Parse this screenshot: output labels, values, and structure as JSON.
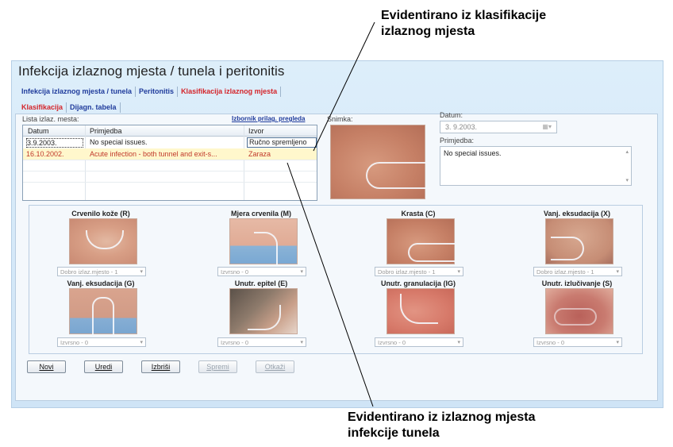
{
  "callouts": {
    "top": "Evidentirano iz klasifikacije\nizlaznog mjesta",
    "bottom": "Evidentirano iz izlaznog mjesta\ninfekcije tunela"
  },
  "window": {
    "title": "Infekcija izlaznog mjesta / tunela i peritonitis",
    "tabs": [
      {
        "label": "Infekcija izlaznog mjesta / tunela",
        "active": false
      },
      {
        "label": "Peritonitis",
        "active": false
      },
      {
        "label": "Klasifikacija izlaznog mjesta",
        "active": true
      }
    ],
    "subtabs": [
      {
        "label": "Klasifikacija",
        "active": true
      },
      {
        "label": "Dijagn. tabela",
        "active": false
      }
    ]
  },
  "list": {
    "label": "Lista izlaz. mesta:",
    "link": "Izbornik prilag. pregleda",
    "columns": [
      "Datum",
      "Primjedba",
      "Izvor"
    ],
    "rows": [
      {
        "date": "3.9.2003.",
        "note": "No special issues.",
        "source": "Ručno spremljeno"
      },
      {
        "date": "16.10.2002.",
        "note": "Acute infection - both tunnel and exit-s...",
        "source": "Zaraza"
      }
    ]
  },
  "details": {
    "snimka_label": "Snimka:",
    "datum_label": "Datum:",
    "datum_value": "3.  9.2003.",
    "primjedba_label": "Primjedba:",
    "primjedba_value": "No special issues."
  },
  "categories": [
    {
      "title": "Crvenilo kože (R)",
      "value": "Dobro izlaz.mjesto - 1",
      "photo": "skin1"
    },
    {
      "title": "Mjera crvenila (M)",
      "value": "Izvrsno - 0",
      "photo": "skin2"
    },
    {
      "title": "Krasta (C)",
      "value": "Dobro izlaz.mjesto - 1",
      "photo": "skin3"
    },
    {
      "title": "Vanj. eksudacija (X)",
      "value": "Dobro izlaz.mjesto - 1",
      "photo": "skin4"
    },
    {
      "title": "Vanj. eksudacija (G)",
      "value": "Izvrsno - 0",
      "photo": "skin5"
    },
    {
      "title": "Unutr. epitel (E)",
      "value": "Izvrsno - 0",
      "photo": "skin6"
    },
    {
      "title": "Unutr. granulacija (IG)",
      "value": "Izvrsno - 0",
      "photo": "skin7"
    },
    {
      "title": "Unutr. izlučivanje (S)",
      "value": "Izvrsno - 0",
      "photo": "skin8"
    }
  ],
  "buttons": {
    "novi": "Novi",
    "uredi": "Uredi",
    "izbrisi": "Izbriši",
    "spremi": "Spremi",
    "otkazi": "Otkaži"
  },
  "colors": {
    "tab_blue": "#1f3b9c",
    "tab_red": "#d4242a",
    "highlight_row": "#fff7cc"
  }
}
